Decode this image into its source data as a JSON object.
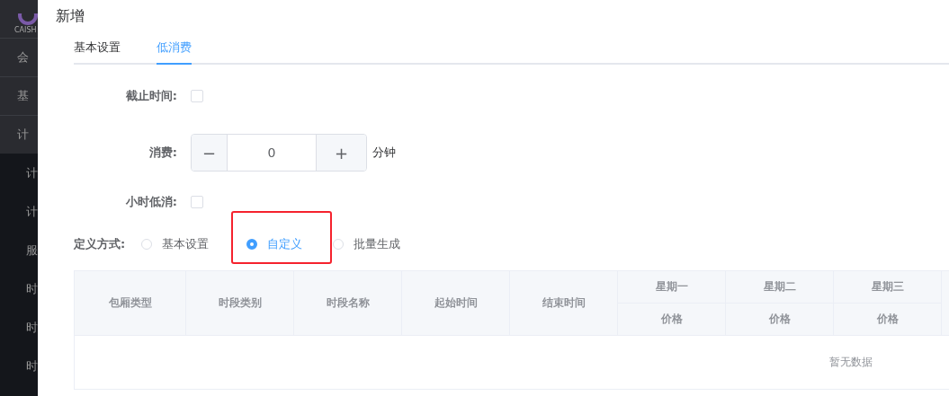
{
  "sidebar": {
    "logo_text": "CAISH",
    "items": [
      {
        "label": "会"
      },
      {
        "label": "基"
      },
      {
        "label": "计",
        "children": [
          {
            "label": "计"
          },
          {
            "label": "计"
          },
          {
            "label": "服"
          },
          {
            "label": "时"
          },
          {
            "label": "时"
          },
          {
            "label": "时"
          }
        ]
      }
    ]
  },
  "dialog": {
    "title": "新增",
    "tabs": [
      {
        "label": "基本设置",
        "selected": false
      },
      {
        "label": "低消费",
        "selected": true
      }
    ],
    "fields": [
      {
        "kind": "checkbox",
        "label": "截止时间:",
        "checked": false
      },
      {
        "kind": "stepper",
        "label": "消费:",
        "minus": "−",
        "value": "0",
        "plus": "+",
        "unit": "分钟"
      },
      {
        "kind": "checkbox",
        "label": "小时低消:",
        "checked": false
      }
    ],
    "define_mode": {
      "label": "定义方式:",
      "options": [
        {
          "label": "基本设置",
          "selected": false,
          "highlighted": false
        },
        {
          "label": "自定义",
          "selected": true,
          "highlighted": true
        },
        {
          "label": "批量生成",
          "selected": false,
          "highlighted": false
        }
      ]
    },
    "table": {
      "columns": [
        {
          "label": "包厢类型"
        },
        {
          "label": "时段类别"
        },
        {
          "label": "时段名称"
        },
        {
          "label": "起始时间"
        },
        {
          "label": "结束时间"
        },
        {
          "label": "星期一",
          "sub": "价格"
        },
        {
          "label": "星期二",
          "sub": "价格"
        },
        {
          "label": "星期三",
          "sub": "价格"
        }
      ],
      "empty_text": "暂无数据"
    }
  }
}
